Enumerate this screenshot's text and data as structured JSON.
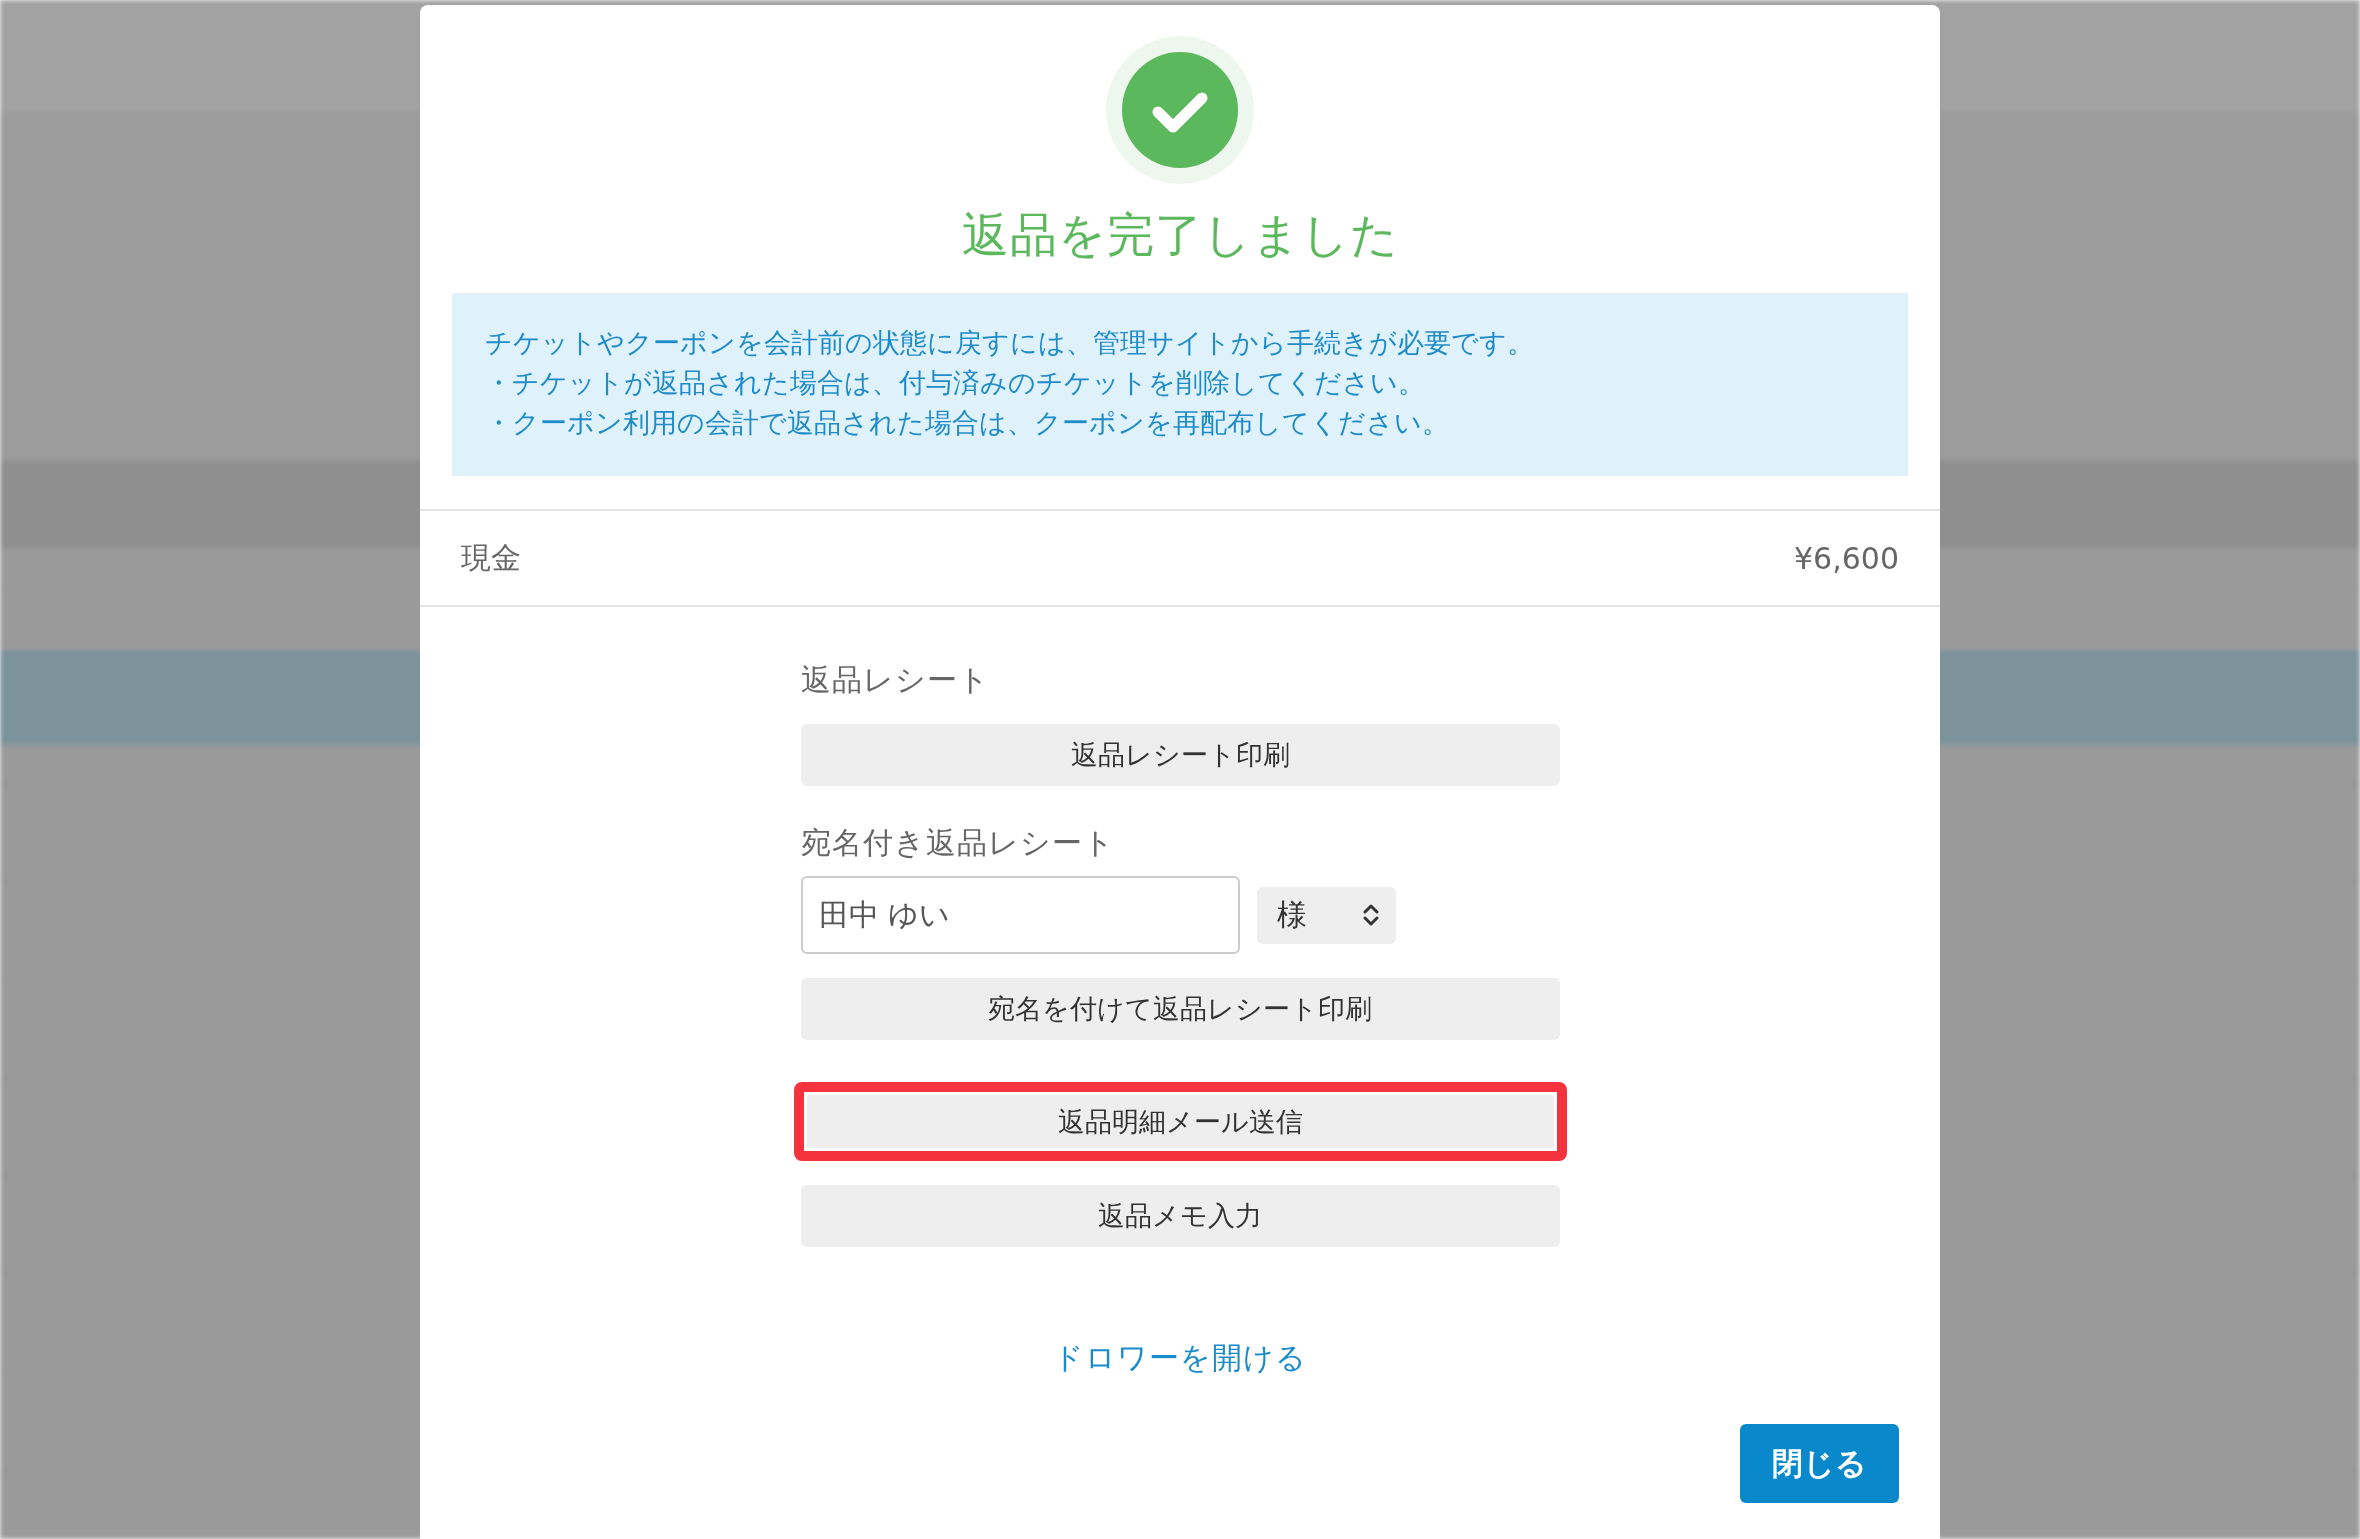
{
  "dialog": {
    "title": "返品を完了しました",
    "notice": [
      "チケットやクーポンを会計前の状態に戻すには、管理サイトから手続きが必要です。",
      "・チケットが返品された場合は、付与済みのチケットを削除してください。",
      "・クーポン利用の会計で返品された場合は、クーポンを再配布してください。"
    ],
    "payment": {
      "method": "現金",
      "amount": "¥6,600"
    },
    "actions": [
      {
        "kind": "heading",
        "text": "返品レシート"
      },
      {
        "kind": "button",
        "label": "返品レシート印刷",
        "highlighted": false
      },
      {
        "kind": "heading",
        "text": "宛名付き返品レシート"
      },
      {
        "kind": "name_row",
        "input": {
          "value": "田中 ゆい"
        },
        "select": {
          "value": "様"
        }
      },
      {
        "kind": "button",
        "label": "宛名を付けて返品レシート印刷",
        "highlighted": false
      },
      {
        "kind": "button",
        "label": "返品明細メール送信",
        "highlighted": true
      },
      {
        "kind": "button",
        "label": "返品メモ入力",
        "highlighted": false
      }
    ],
    "link": "ドロワーを開ける",
    "close_button": "閉じる"
  }
}
